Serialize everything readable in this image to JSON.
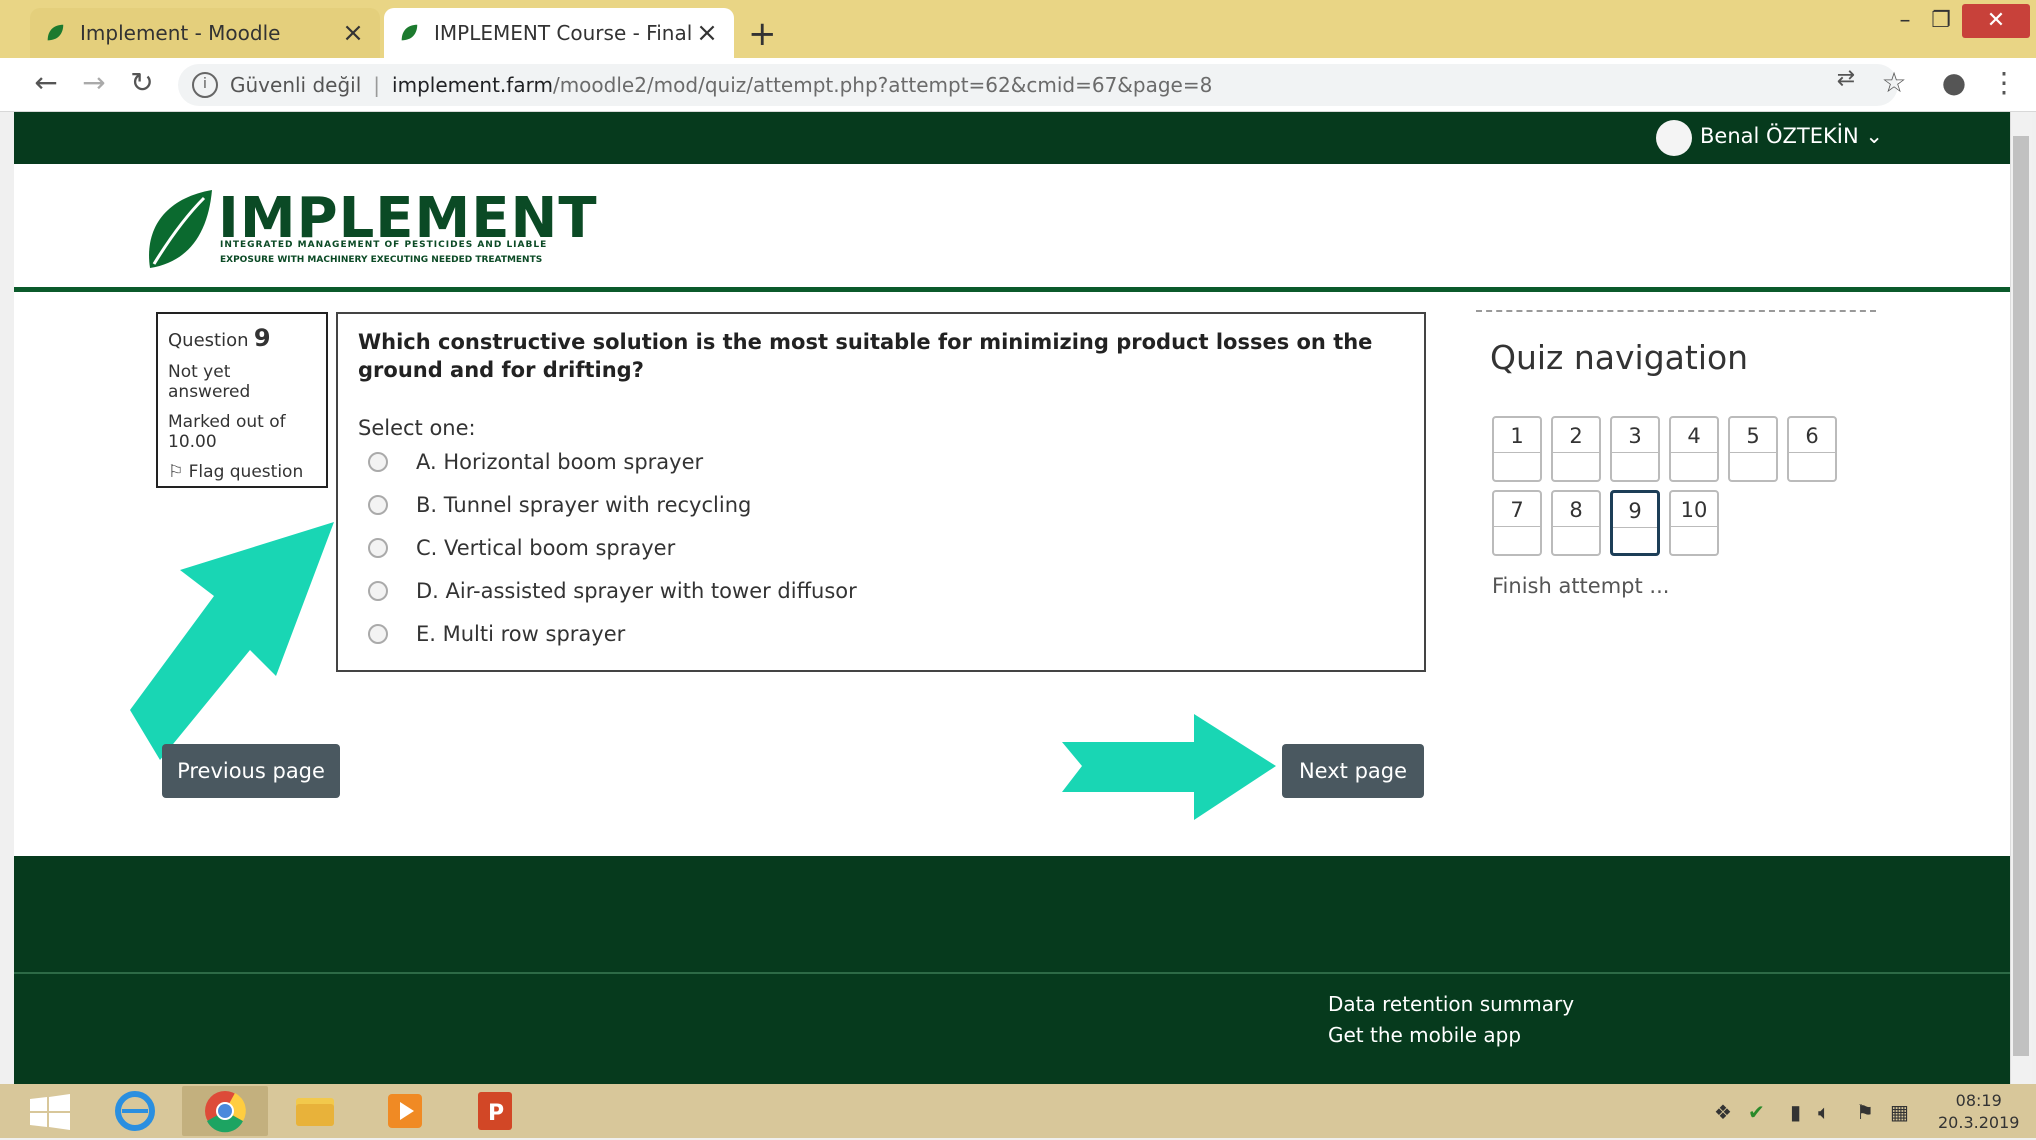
{
  "browser": {
    "tabs": [
      {
        "title": "Implement - Moodle",
        "active": false
      },
      {
        "title": "IMPLEMENT Course - Final Quest",
        "active": true
      }
    ],
    "security_label": "Güvenli değil",
    "url_host": "implement.farm",
    "url_path": "/moodle2/mod/quiz/attempt.php?attempt=62&cmid=67&page=8"
  },
  "header": {
    "user_name": "Benal ÖZTEKİN",
    "logo_text": "IMPLEMENT",
    "logo_sub1": "INTEGRATED MANAGEMENT OF PESTICIDES AND LIABLE",
    "logo_sub2": "EXPOSURE WITH MACHINERY EXECUTING NEEDED TREATMENTS"
  },
  "question": {
    "label": "Question",
    "number": "9",
    "status": "Not yet answered",
    "marked_out_of": "Marked out of 10.00",
    "flag_label": "Flag question",
    "text": "Which constructive solution is the most suitable for minimizing product losses on the ground and for drifting?",
    "select_one": "Select one:",
    "options": [
      "A. Horizontal boom sprayer",
      "B. Tunnel sprayer with recycling",
      "C. Vertical boom sprayer",
      "D. Air-assisted sprayer with tower diffusor",
      "E. Multi row sprayer"
    ]
  },
  "quiz_nav": {
    "title": "Quiz navigation",
    "buttons": [
      "1",
      "2",
      "3",
      "4",
      "5",
      "6",
      "7",
      "8",
      "9",
      "10"
    ],
    "current": "9",
    "finish": "Finish attempt ..."
  },
  "buttons": {
    "previous": "Previous page",
    "next": "Next page"
  },
  "footer": {
    "data_retention": "Data retention summary",
    "mobile_app": "Get the mobile app"
  },
  "taskbar": {
    "time": "08:19",
    "date": "20.3.2019"
  },
  "colors": {
    "dark_green": "#063a1d",
    "accent_arrow": "#19d6b4",
    "button_gray": "#4a5860"
  }
}
